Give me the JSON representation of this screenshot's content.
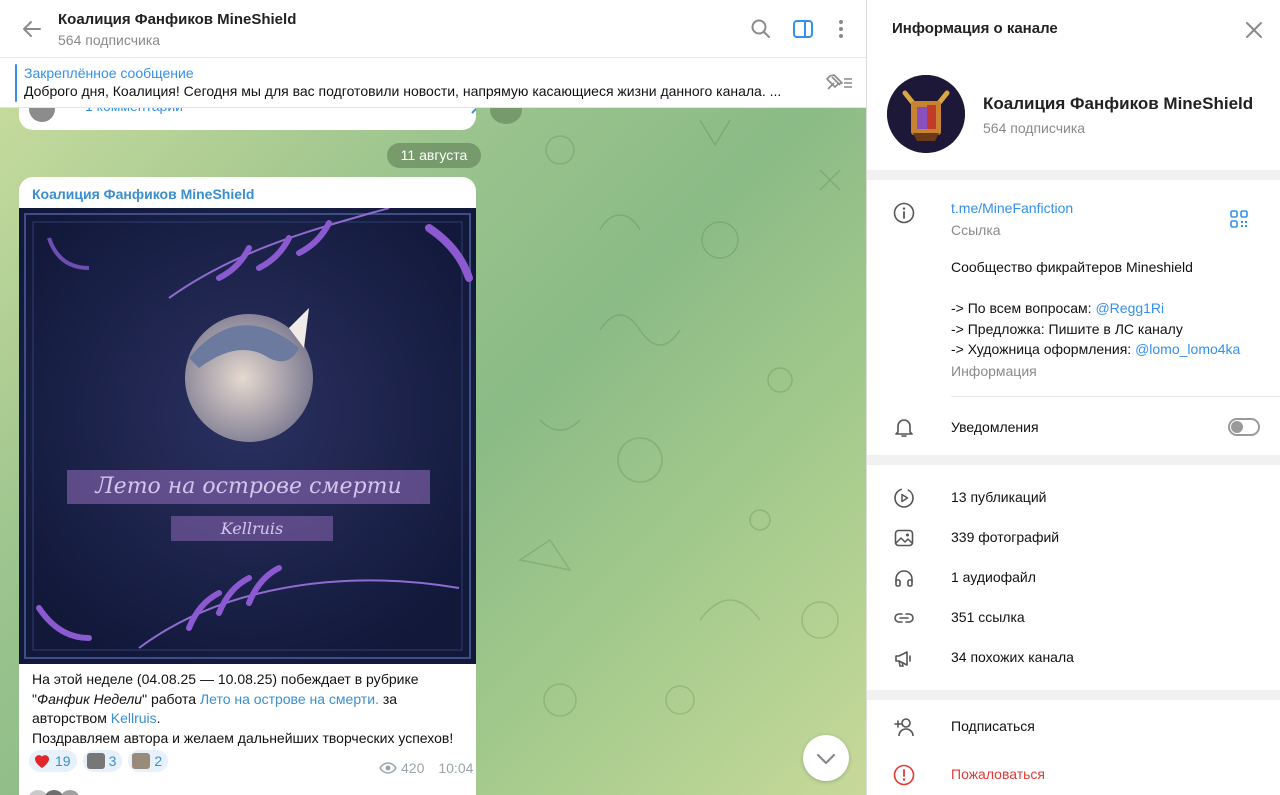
{
  "header": {
    "title": "Коалиция Фанфиков MineShield",
    "subtitle": "564 подписчика"
  },
  "pinned": {
    "title": "Закреплённое сообщение",
    "text": "Доброго дня, Коалиция!  Сегодня мы для вас подготовили новости, напрямую касающиеся жизни данного канала. ..."
  },
  "previous_message": {
    "comments": "1 комментарий"
  },
  "date_separator": "11 августа",
  "message": {
    "author": "Коалиция Фанфиков MineShield",
    "cover_title": "Лето на острове смерти",
    "cover_author": "Kellruis",
    "text_1": "На этой неделе (04.08.25 — 10.08.25) побеждает в рубрике",
    "text_2a": "\"",
    "text_2_em": "Фанфик Недели",
    "text_2b": "\" работа ",
    "text_2_link": "Лето на острове на смерти.",
    "text_2c": " за",
    "text_3a": "авторством ",
    "text_3_link": "Kellruis",
    "text_3b": ".",
    "text_4": "Поздравляем автора и желаем дальнейших творческих успехов!",
    "reactions": [
      {
        "emoji": "red-heart",
        "count": "19"
      },
      {
        "emoji": "custom-sticker-1",
        "count": "3"
      },
      {
        "emoji": "custom-sticker-2",
        "count": "2"
      }
    ],
    "views": "420",
    "time": "10:04"
  },
  "side_panel": {
    "title": "Информация о канале",
    "channel_name": "Коалиция Фанфиков MineShield",
    "channel_sub": "564 подписчика",
    "link": "t.me/MineFanfiction",
    "link_label": "Ссылка",
    "desc_line1": "Сообщество фикрайтеров Mineshield",
    "desc_line2a": "-> По всем вопросам: ",
    "desc_line2_link": "@Regg1Ri",
    "desc_line3": "-> Предложка: Пишите в ЛС каналу",
    "desc_line4a": "-> Художница оформления: ",
    "desc_line4_link": "@lomo_lomo4ka",
    "desc_label": "Информация",
    "notifications": "Уведомления",
    "notifications_on": false,
    "stats": {
      "posts": "13 публикаций",
      "photos": "339 фотографий",
      "audio": "1 аудиофайл",
      "links": "351 ссылка",
      "similar": "34 похожих канала"
    },
    "subscribe": "Подписаться",
    "report": "Пожаловаться"
  },
  "colors": {
    "accent": "#3390ec",
    "author": "#3a8fd0",
    "danger": "#e53935",
    "chat_bg_start": "#cfe0a0",
    "chat_bg_mid": "#8bbb86"
  }
}
